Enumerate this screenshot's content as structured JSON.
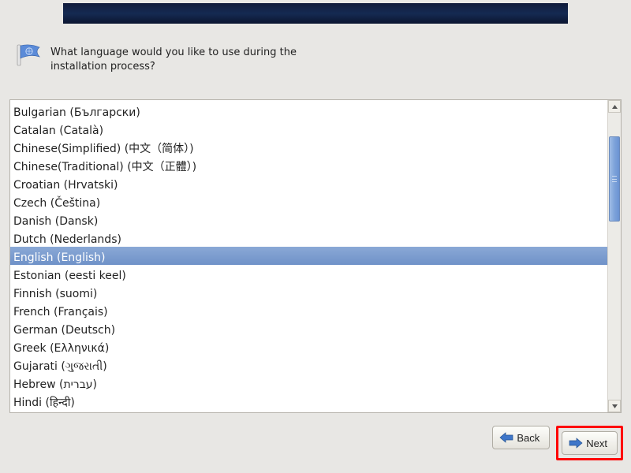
{
  "prompt": "What language would you like to use during the installation process?",
  "selected_index": 8,
  "languages": [
    "Bulgarian (Български)",
    "Catalan (Català)",
    "Chinese(Simplified) (中文（简体）)",
    "Chinese(Traditional) (中文（正體）)",
    "Croatian (Hrvatski)",
    "Czech (Čeština)",
    "Danish (Dansk)",
    "Dutch (Nederlands)",
    "English (English)",
    "Estonian (eesti keel)",
    "Finnish (suomi)",
    "French (Français)",
    "German (Deutsch)",
    "Greek (Ελληνικά)",
    "Gujarati (ગુજરાતી)",
    "Hebrew (עברית)",
    "Hindi (हिन्दी)"
  ],
  "buttons": {
    "back": "Back",
    "next": "Next"
  }
}
